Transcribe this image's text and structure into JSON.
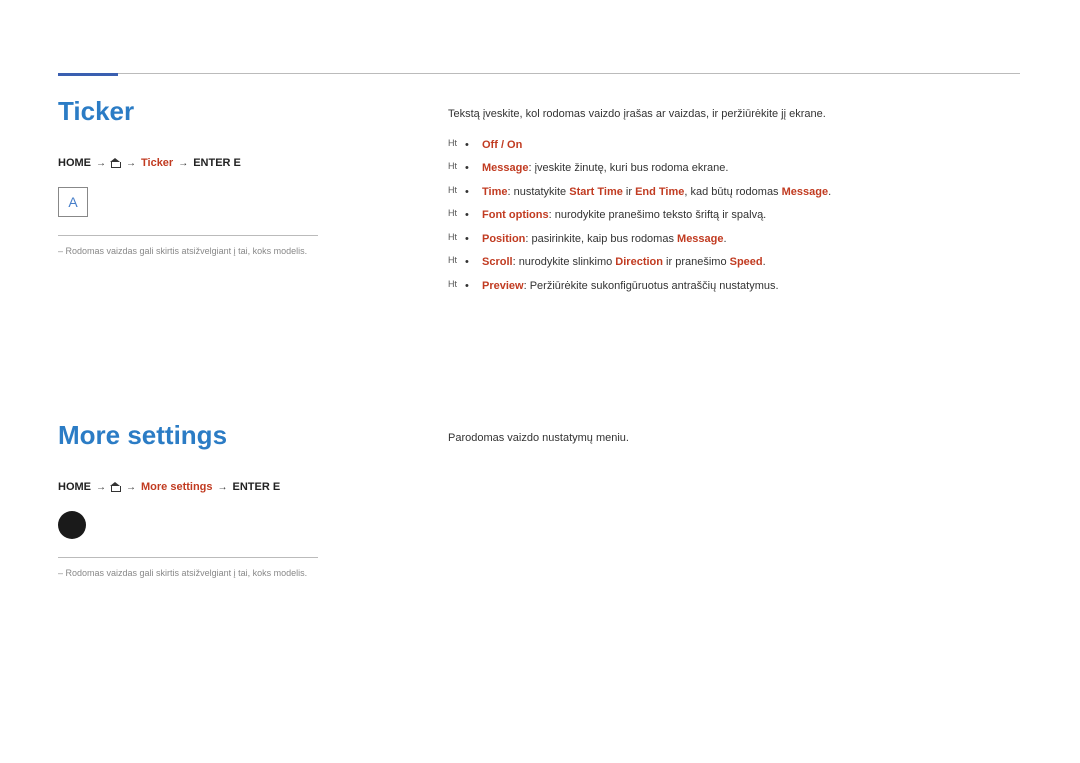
{
  "section1": {
    "title": "Ticker",
    "breadcrumb": {
      "home": "HOME",
      "item1": "Ticker",
      "enter": "ENTER E"
    },
    "preview_letter": "A",
    "note": "Rodomas vaizdas gali skirtis atsižvelgiant į tai, koks modelis.",
    "body_text": "Tekstą įveskite, kol rodomas vaizdo įrašas ar vaizdas, ir peržiūrėkite jį ekrane.",
    "items": [
      {
        "marker": "Ht",
        "html": "<span class=\"hl\">Off / On</span>"
      },
      {
        "marker": "Ht",
        "html": "<span class=\"hl\">Message</span>: įveskite žinutę, kuri bus rodoma ekrane."
      },
      {
        "marker": "Ht",
        "html": "<span class=\"hl\">Time</span>: nustatykite <span class=\"hl\">Start Time</span> ir <span class=\"hl\">End Time</span>, kad būtų rodomas <span class=\"hl\">Message</span>."
      },
      {
        "marker": "Ht",
        "html": "<span class=\"hl\">Font options</span>: nurodykite pranešimo teksto šriftą ir spalvą."
      },
      {
        "marker": "Ht",
        "html": "<span class=\"hl\">Position</span>: pasirinkite, kaip bus rodomas <span class=\"hl\">Message</span>."
      },
      {
        "marker": "Ht",
        "html": "<span class=\"hl\">Scroll</span>: nurodykite slinkimo <span class=\"hl\">Direction</span> ir pranešimo <span class=\"hl\">Speed</span>."
      },
      {
        "marker": "Ht",
        "html": "<span class=\"hl\">Preview</span>: Peržiūrėkite sukonfigūruotus antraščių nustatymus."
      }
    ]
  },
  "section2": {
    "title": "More settings",
    "breadcrumb": {
      "home": "HOME",
      "item1": "More settings",
      "enter": "ENTER E"
    },
    "note": "Rodomas vaizdas gali skirtis atsižvelgiant į tai, koks modelis.",
    "body_text": "Parodomas vaizdo nustatymų meniu."
  }
}
